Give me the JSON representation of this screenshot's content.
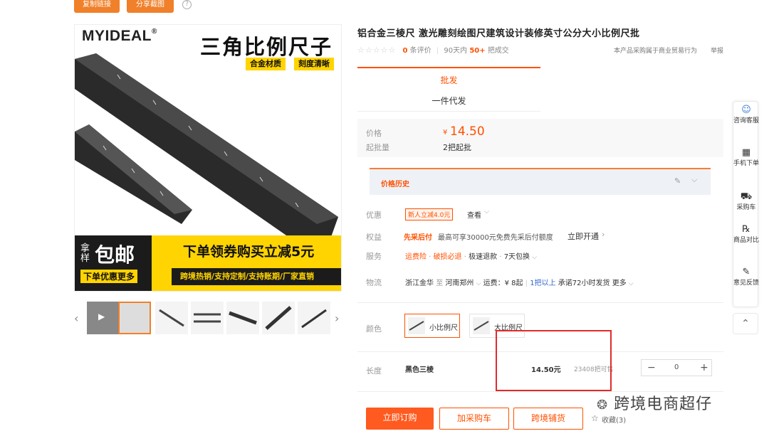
{
  "top_buttons": {
    "copy_link": "复制链接",
    "share_screenshot": "分享截图",
    "help": "?"
  },
  "main_image": {
    "brand": "MYIDEAL",
    "brand_mark": "®",
    "headline": "三角比例尺子",
    "tag1": "合金材质",
    "tag2": "刻度清晰",
    "take_sample": "拿样",
    "free_ship": "包邮",
    "order_more": "下单优惠更多",
    "promo": "下单领券购买立减5元",
    "promo_line": "跨境热销/支持定制/支持账期/厂家直销"
  },
  "product": {
    "title": "铝合金三棱尺 激光雕刻绘图尺建筑设计装修英寸公分大小比例尺批",
    "stars": "☆☆☆☆☆",
    "review_count": "0",
    "review_label": "条评价",
    "days_label": "90天内",
    "sold_count": "50+",
    "sold_label": "把成交",
    "purchase_note": "本产品采购属于商业贸易行为",
    "report": "举报"
  },
  "tabs": {
    "wholesale": "批发",
    "dropship": "一件代发"
  },
  "price": {
    "price_label": "价格",
    "currency": "¥",
    "value": "14.50",
    "moq_label": "起批量",
    "moq": "2把起批"
  },
  "price_history": "价格历史",
  "offers": {
    "discount_label": "优惠",
    "coupon": "新人立减4.0元",
    "view": "查看",
    "benefit_label": "权益",
    "benefit_name": "先采后付",
    "benefit_desc": "最高可享30000元免费先采后付额度",
    "benefit_link": "立即开通",
    "service_label": "服务",
    "service1": "运费险",
    "service2": "破损必退",
    "service3": "极速退款",
    "service4": "7天包换",
    "logistics_label": "物流",
    "from": "浙江金华",
    "to_word": "至",
    "to": "河南郑州",
    "freight": "运费：¥ 8起",
    "delivery_cond": "1把以上",
    "delivery_promise": "承诺72小时发货",
    "more": "更多"
  },
  "sku": {
    "color_label": "颜色",
    "colors": [
      "小比例尺",
      "大比例尺"
    ],
    "length_label": "长度",
    "variant": "黑色三棱",
    "variant_price": "14.50元",
    "stock": "23408把可售",
    "qty": "0",
    "minus": "−",
    "plus": "+"
  },
  "actions": {
    "buy_now": "立即订购",
    "add_cart": "加采购车",
    "cross_border": "跨境铺货",
    "favorite": "收藏(3)"
  },
  "sidebar": {
    "consult": "咨询客服",
    "mobile_order": "手机下单",
    "cart": "采购车",
    "compare": "商品对比",
    "feedback": "意见反馈"
  },
  "watermark": "跨境电商超仔",
  "colors": {
    "accent": "#ff5000",
    "banner_yellow": "#ffd400",
    "frame_red": "#e12b2b"
  }
}
